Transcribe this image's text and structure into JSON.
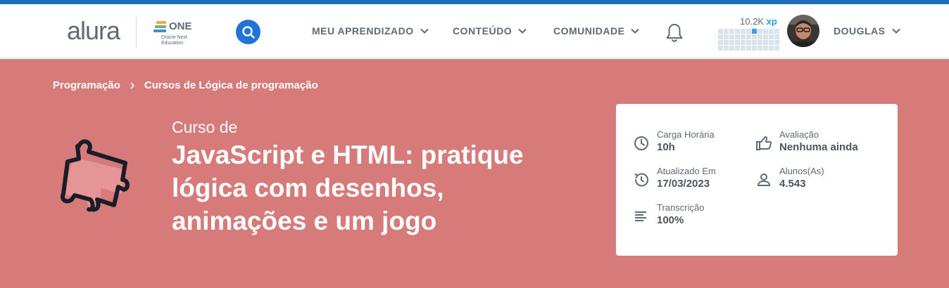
{
  "header": {
    "logo": "alura",
    "partner_logo": {
      "name": "ONE",
      "subtitle_line1": "Oracle Next",
      "subtitle_line2": "Education"
    },
    "nav": [
      {
        "label": "MEU APRENDIZADO"
      },
      {
        "label": "CONTEÚDO"
      },
      {
        "label": "COMUNIDADE"
      }
    ],
    "xp": {
      "value": "10.2K",
      "unit": "xp"
    },
    "user": {
      "name": "DOUGLAS"
    }
  },
  "breadcrumb": [
    {
      "label": "Programação"
    },
    {
      "label": "Cursos de Lógica de programação"
    }
  ],
  "course": {
    "label": "Curso de",
    "title": "JavaScript e HTML: pratique lógica com desenhos, animações e um jogo",
    "icon": "puzzle-piece-icon"
  },
  "info": {
    "workload": {
      "label": "Carga Horária",
      "value": "10h",
      "icon": "clock-icon"
    },
    "rating": {
      "label": "Avaliação",
      "value": "Nenhuma ainda",
      "icon": "thumbs-up-icon"
    },
    "updated": {
      "label": "Atualizado Em",
      "value": "17/03/2023",
      "icon": "history-icon"
    },
    "students": {
      "label": "Alunos(As)",
      "value": "4.543",
      "icon": "user-icon"
    },
    "transcript": {
      "label": "Transcrição",
      "value": "100%",
      "icon": "lines-icon"
    }
  },
  "colors": {
    "top_line": "#1d70b7",
    "hero_background": "#d77a7a",
    "search_button": "#2173d6",
    "xp_accent": "#2a9fe0",
    "text_gray": "#5f6a72"
  }
}
